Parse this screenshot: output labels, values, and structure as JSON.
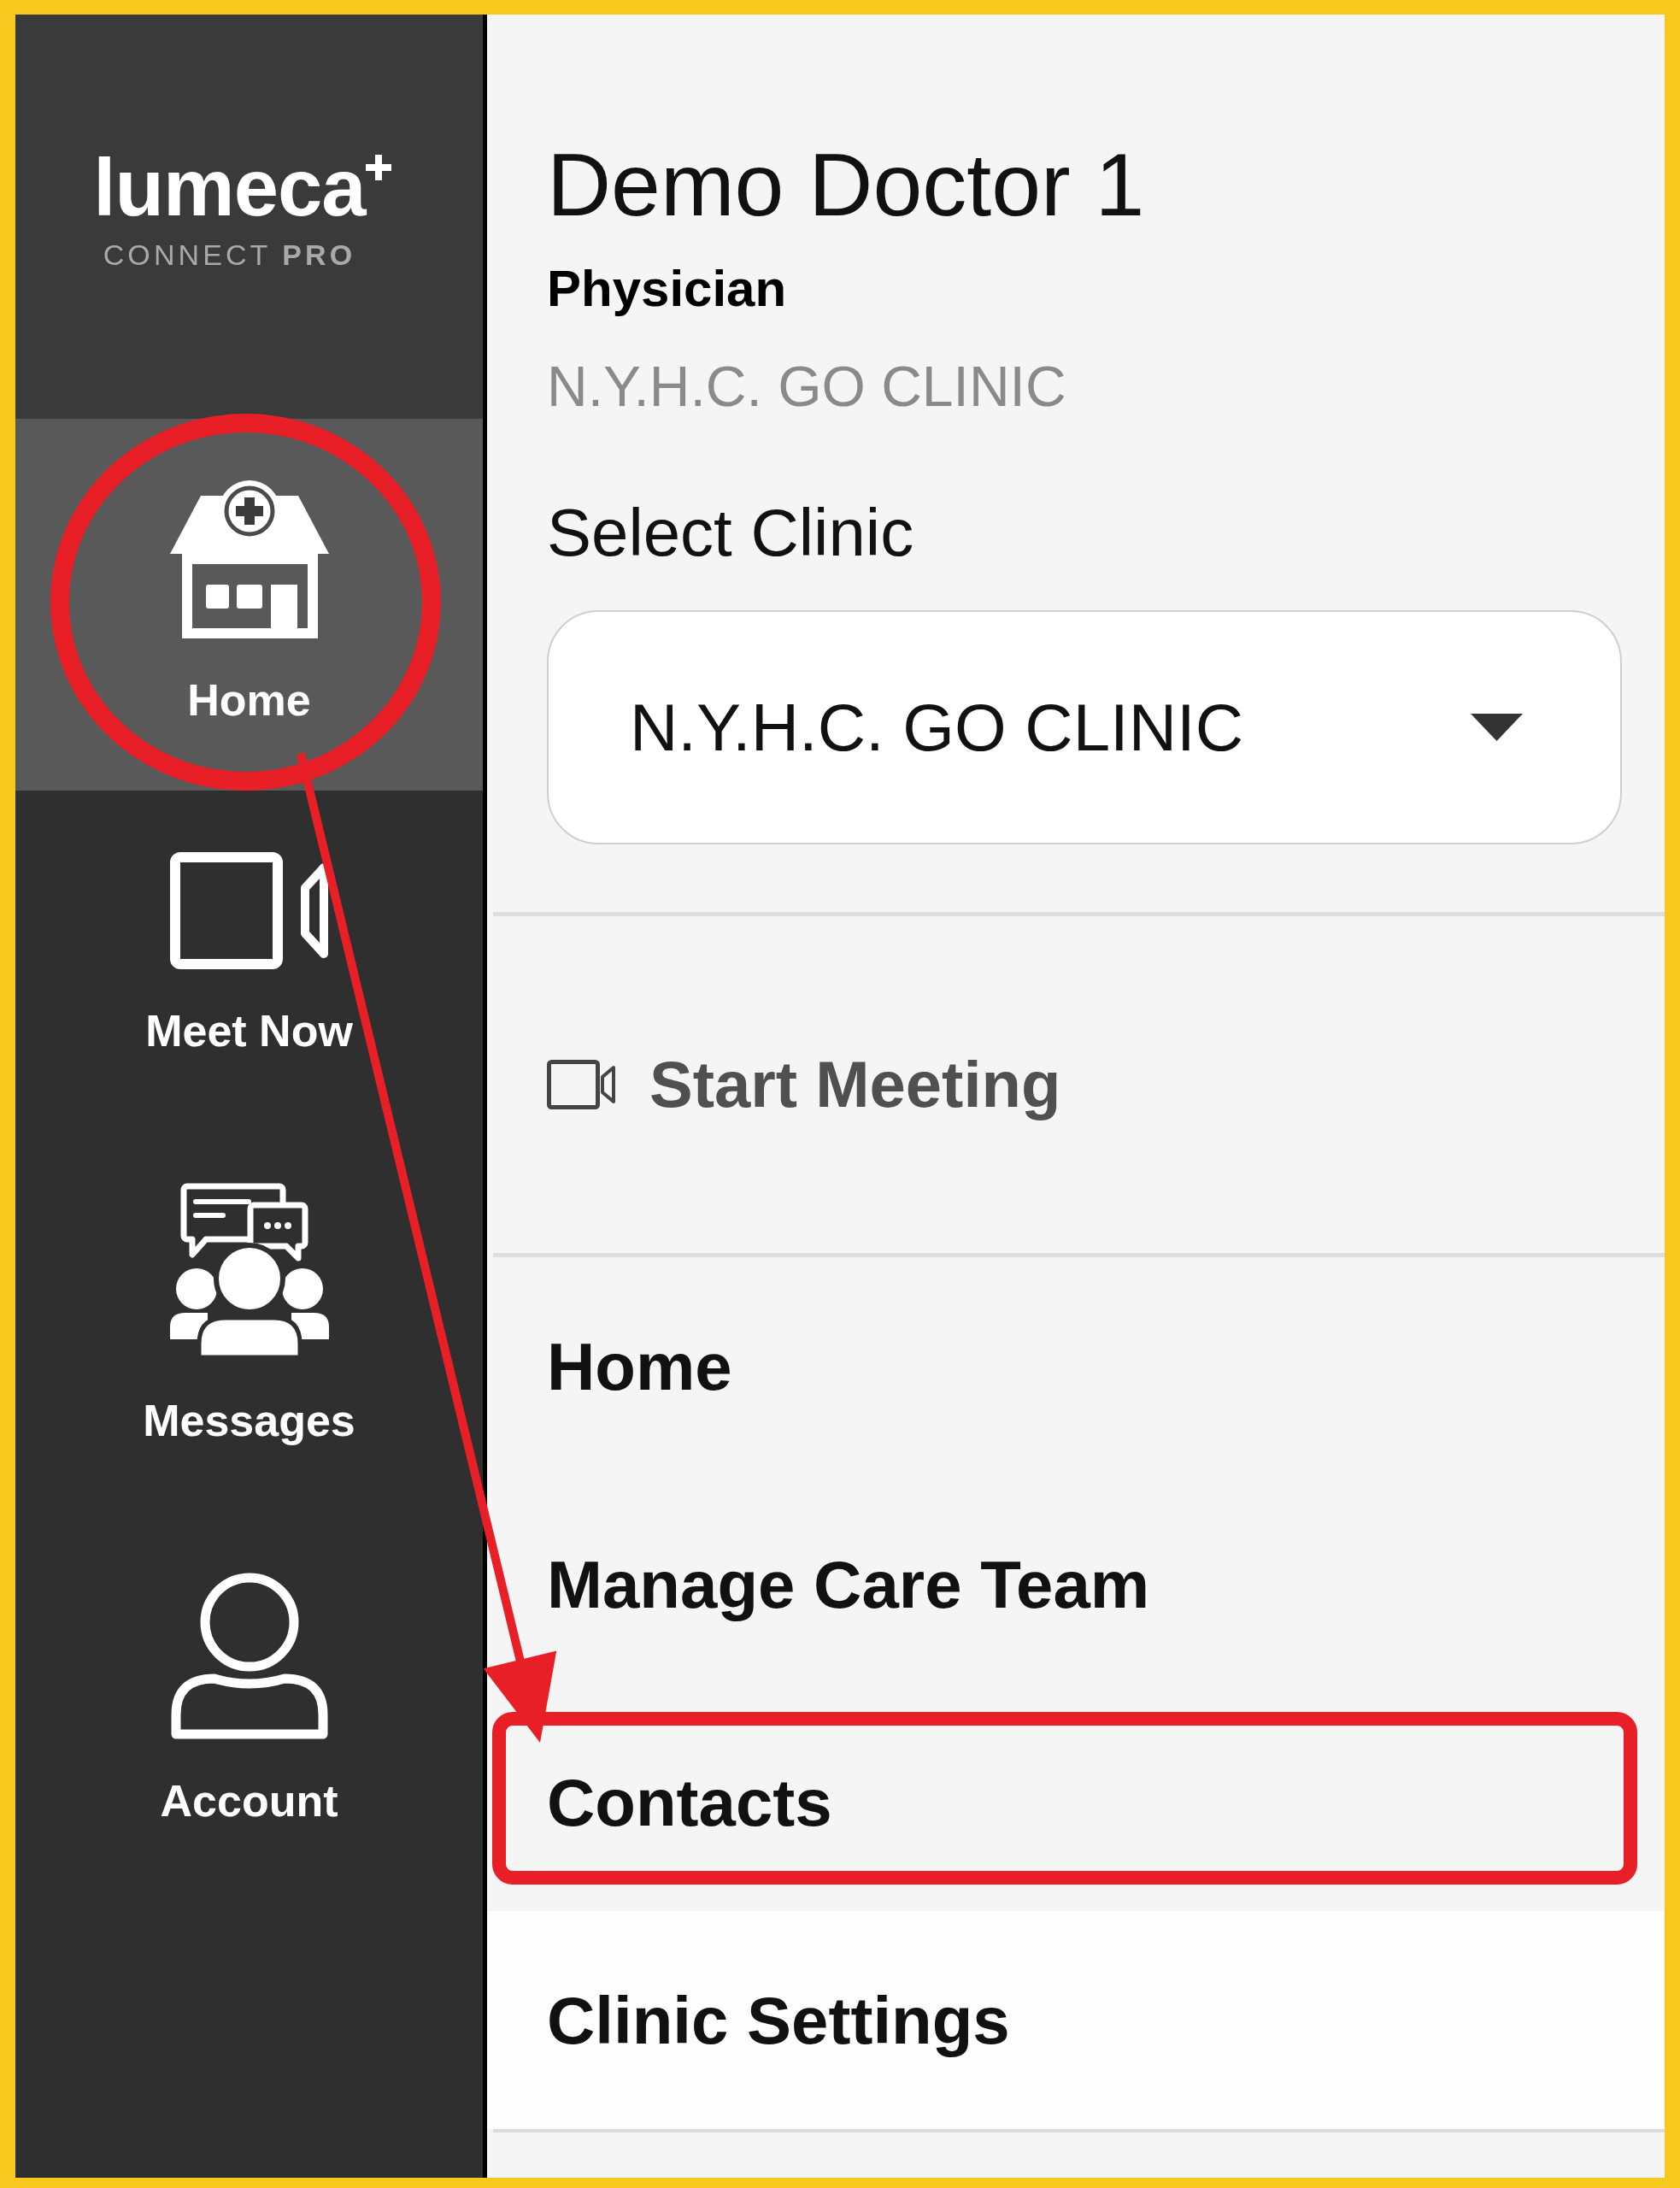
{
  "sidebar": {
    "logo": {
      "wordmark": "lumeca",
      "tagline": "CONNECT **PRO**"
    },
    "items": [
      {
        "label": "Home",
        "selected": true,
        "circled": true
      },
      {
        "label": "Meet Now",
        "selected": false,
        "circled": false
      },
      {
        "label": "Messages",
        "selected": false,
        "circled": false
      },
      {
        "label": "Account",
        "selected": false,
        "circled": false
      }
    ]
  },
  "profile": {
    "name": "Demo Doctor 1",
    "role": "Physician",
    "clinic": "N.Y.H.C. GO CLINIC"
  },
  "clinic_select": {
    "label": "Select Clinic",
    "value": "N.Y.H.C. GO CLINIC"
  },
  "start_meeting": {
    "label": "Start Meeting"
  },
  "menu": {
    "items": [
      {
        "label": "Home",
        "hovered": false,
        "outlined": false
      },
      {
        "label": "Manage Care Team",
        "hovered": false,
        "outlined": false
      },
      {
        "label": "Contacts",
        "hovered": false,
        "outlined": true
      },
      {
        "label": "Clinic Settings",
        "hovered": true,
        "outlined": false
      }
    ]
  }
}
